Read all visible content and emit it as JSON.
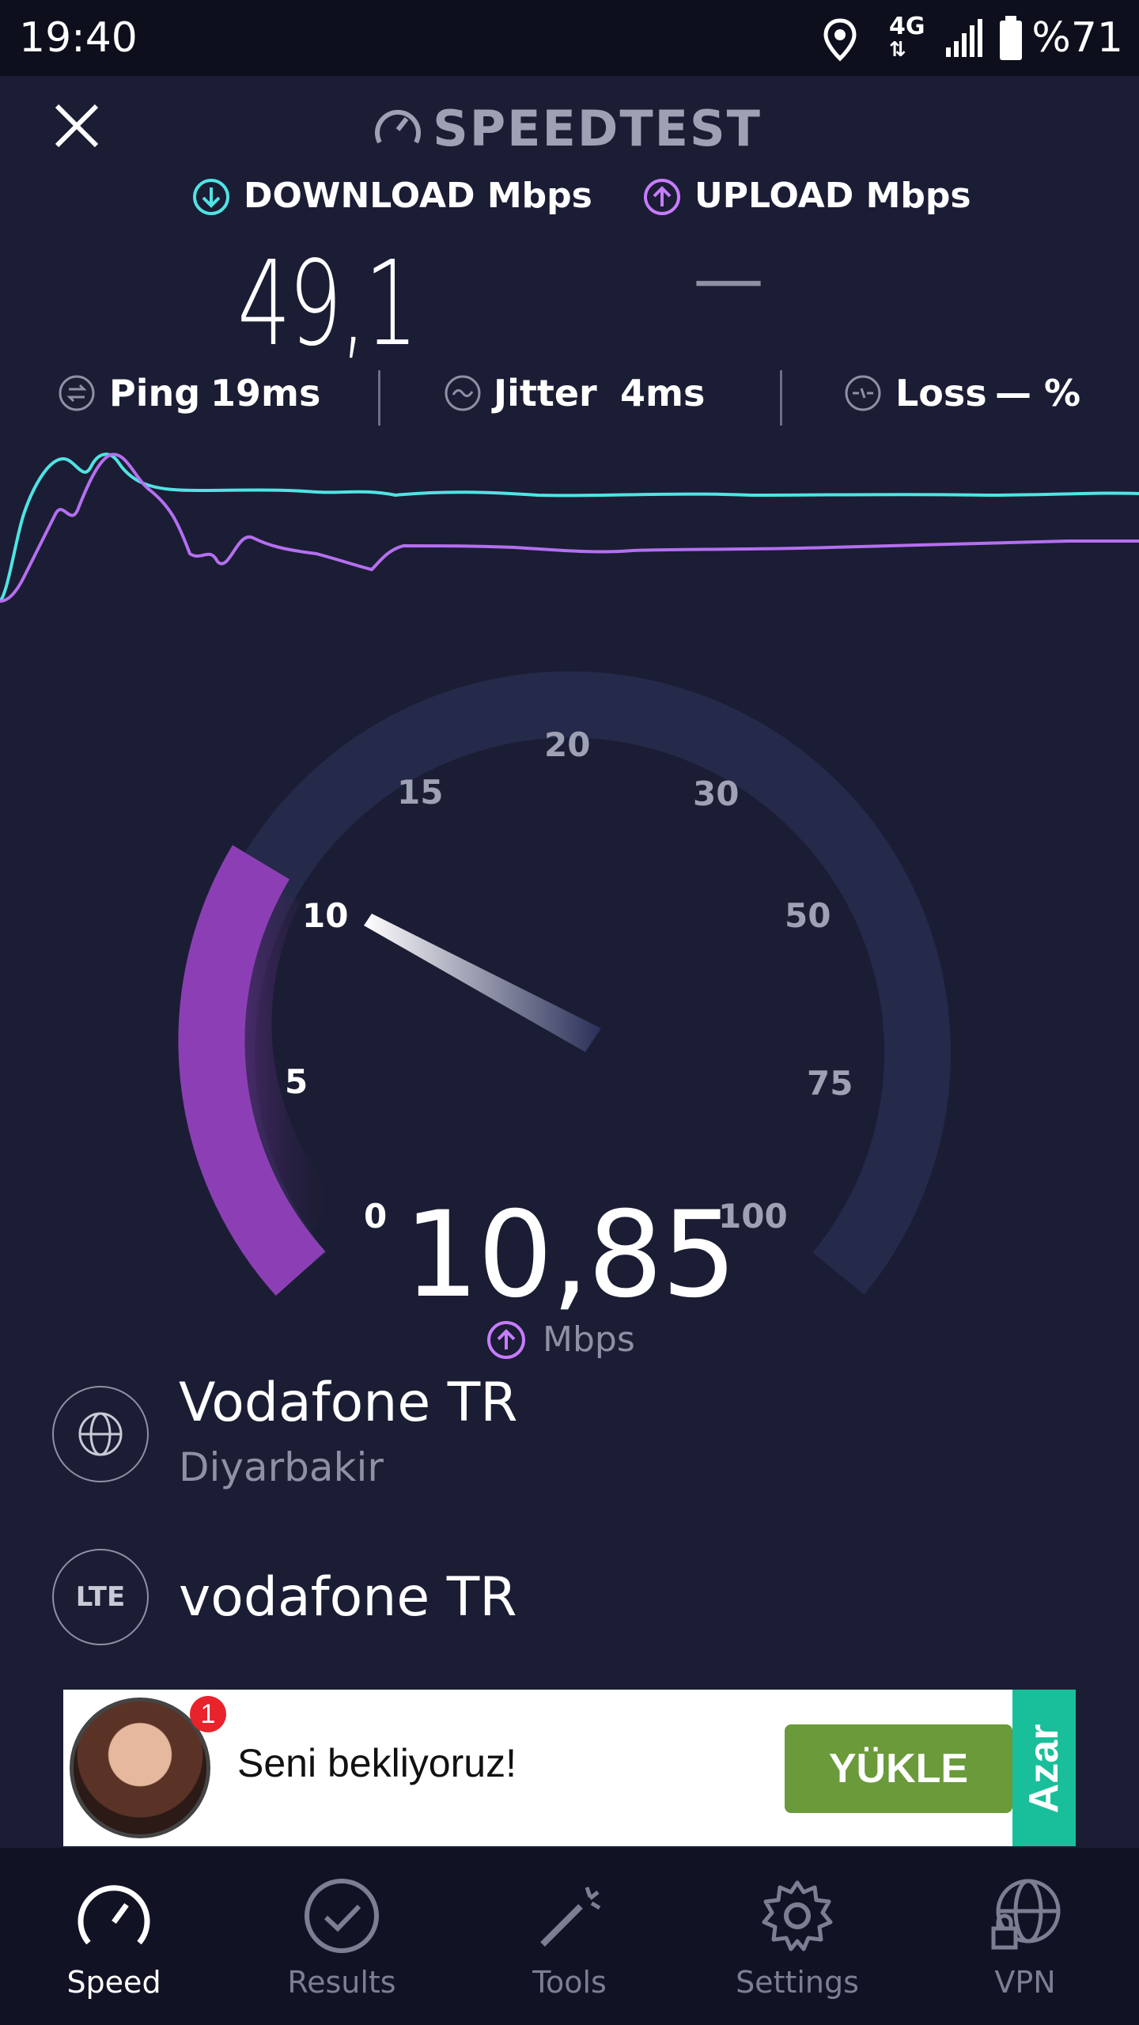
{
  "status_bar": {
    "time": "19:40",
    "network": "4G",
    "battery": "%71"
  },
  "header": {
    "title": "SPEEDTEST"
  },
  "download": {
    "label": "DOWNLOAD Mbps",
    "value": "49,1"
  },
  "upload": {
    "label": "UPLOAD Mbps",
    "value": "—"
  },
  "metrics": {
    "ping_label": "Ping",
    "ping_value": "19ms",
    "jitter_label": "Jitter",
    "jitter_value": "4ms",
    "loss_label": "Loss",
    "loss_value": "— %"
  },
  "gauge": {
    "ticks": [
      "0",
      "5",
      "10",
      "15",
      "20",
      "30",
      "50",
      "75",
      "100"
    ],
    "current_value": "10,85",
    "unit": "Mbps",
    "colors": {
      "track": "#252a4a",
      "upload_fill": "#8c3fb5",
      "download_line": "#4fe4e4",
      "upload_line": "#b56ff0"
    }
  },
  "server": {
    "isp": "Vodafone TR",
    "city": "Diyarbakir"
  },
  "connection": {
    "type_icon": "LTE",
    "carrier": "vodafone TR"
  },
  "ad": {
    "text": "Seni bekliyoruz!",
    "button": "YÜKLE",
    "brand": "Azar",
    "badge": "1"
  },
  "nav": [
    {
      "label": "Speed",
      "icon": "speed-gauge-icon",
      "active": true
    },
    {
      "label": "Results",
      "icon": "check-circle-icon",
      "active": false
    },
    {
      "label": "Tools",
      "icon": "magic-wand-icon",
      "active": false
    },
    {
      "label": "Settings",
      "icon": "gear-icon",
      "active": false
    },
    {
      "label": "VPN",
      "icon": "globe-lock-icon",
      "active": false
    }
  ]
}
